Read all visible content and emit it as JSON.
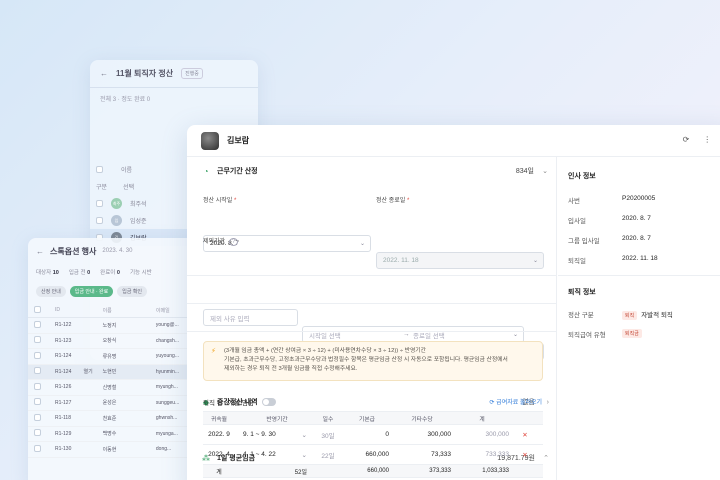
{
  "back1": {
    "title": "11월 퇴직자 정산",
    "tag": "진행중",
    "summary": "전체 3 · 정도 완료 0",
    "col_name": "이름",
    "col_group": "구분",
    "col_status": "선택",
    "rows": [
      {
        "initial": "최주",
        "name": "최주석"
      },
      {
        "initial": "임",
        "name": "임성준"
      },
      {
        "initial": "김",
        "name": "김보람"
      }
    ]
  },
  "back2": {
    "title": "스톡옵션 행사",
    "date": "2023. 4. 30",
    "stats": [
      {
        "label": "대상자",
        "value": "10"
      },
      {
        "label": "입금 전",
        "value": "0"
      },
      {
        "label": "완료이",
        "value": "0"
      },
      {
        "label": "기능 시반",
        "value": ""
      }
    ],
    "chips": [
      "산정 안내",
      "입금 안내 · 완료",
      "입금 확인"
    ],
    "headers": [
      "ID",
      "",
      "이름",
      "이메일"
    ],
    "rows": [
      {
        "id": "R1-122",
        "tag": "",
        "name": "노정지",
        "email": "young@..."
      },
      {
        "id": "R1-123",
        "tag": "",
        "name": "오창식",
        "email": "changsh..."
      },
      {
        "id": "R1-124",
        "tag": "",
        "name": "류유명",
        "email": "yuyoung..."
      },
      {
        "id": "R1-124",
        "tag": "열기",
        "name": "노현민",
        "email": "hyunmin..."
      },
      {
        "id": "R1-126",
        "tag": "",
        "name": "신명철",
        "email": "myungh..."
      },
      {
        "id": "R1-127",
        "tag": "",
        "name": "윤성은",
        "email": "sunggeu..."
      },
      {
        "id": "R1-118",
        "tag": "",
        "name": "천효준",
        "email": "ghwnsh..."
      },
      {
        "id": "R1-129",
        "tag": "",
        "name": "백명수",
        "email": "myunga..."
      },
      {
        "id": "R1-130",
        "tag": "",
        "name": "이동현",
        "email": "dong..."
      }
    ]
  },
  "main": {
    "name": "김보람",
    "period": {
      "title": "근무기간 산정",
      "value": "834일"
    },
    "start_label": "정산 시작일",
    "start_value": "2020. 8. 7",
    "end_label": "정산 종료일",
    "end_value": "2022. 11. 18",
    "excl_label": "제외기간",
    "excl_reason_ph": "제외 사유 입력",
    "excl_start_ph": "시작일 선택",
    "excl_end_ph": "종료일 선택",
    "mid": {
      "title": "중간정산 내역",
      "value": "없음"
    },
    "wage": {
      "title": "1일 평균임금",
      "value": "19,871.79원"
    },
    "notice_line1": "(3개월 임금 총액 + (연간 상여금 × 3 ÷ 12) + (미사용연차수당 × 3 ÷ 12)) ÷ 반영기간",
    "notice_line2": "기본급, 초과근무수당, 고정초과근무수당과 법정필수 항목은 평균임금 산정 시 자동으로 포함됩니다. 평균임금 산정에서",
    "notice_line3": "제외하는 경우 퇴직 전 3개월 임금을 직접 수정해주세요.",
    "pre3_title": "퇴직 전 3개월 임금",
    "reload_label": "급여자료 불러오기",
    "headers": [
      "귀속월",
      "반영기간",
      "일수",
      "기본급",
      "기타수당",
      "계"
    ],
    "rows": [
      {
        "month": "2022. 9",
        "range": "9. 1 ~ 9. 30",
        "days": "30일",
        "base": "0",
        "other": "300,000",
        "sum": "300,000"
      },
      {
        "month": "2022. 4",
        "range": "4. 1 ~ 4. 22",
        "days": "22일",
        "base": "660,000",
        "other": "73,333",
        "sum": "733,333"
      }
    ],
    "total": {
      "label": "계",
      "days": "52일",
      "base": "660,000",
      "other": "373,333",
      "sum": "1,033,333"
    }
  },
  "hr": {
    "title": "인사 정보",
    "fields": [
      {
        "k": "사번",
        "v": "P20200005"
      },
      {
        "k": "입사일",
        "v": "2020. 8. 7"
      },
      {
        "k": "그룹 입사일",
        "v": "2020. 8. 7"
      },
      {
        "k": "퇴직일",
        "v": "2022. 11. 18"
      }
    ],
    "retire_title": "퇴직 정보",
    "settle_label": "정산 구분",
    "settle_badge": "퇴직",
    "settle_value": "자발적 퇴직",
    "type_label": "퇴직급여 유형",
    "type_badge": "퇴직금"
  }
}
